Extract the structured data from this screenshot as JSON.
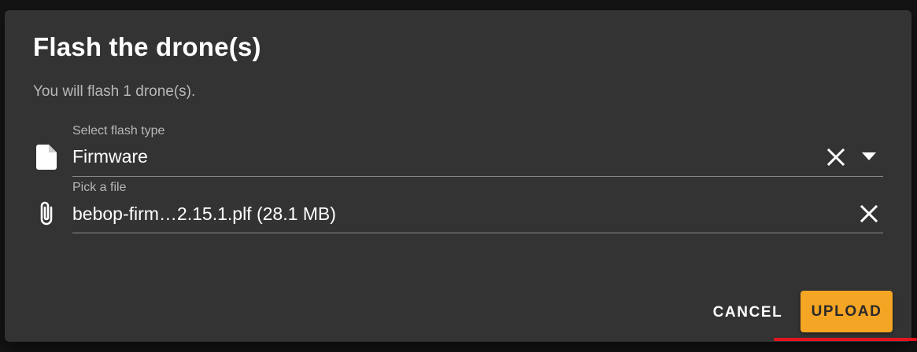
{
  "dialog": {
    "title": "Flash the drone(s)",
    "subtitle": "You will flash 1 drone(s)."
  },
  "flash_type": {
    "label": "Select flash type",
    "value": "Firmware",
    "icon": "file-icon"
  },
  "file_picker": {
    "label": "Pick a file",
    "value": "bebop-firm…2.15.1.plf (28.1 MB)",
    "icon": "paperclip-icon"
  },
  "actions": {
    "cancel_label": "CANCEL",
    "upload_label": "UPLOAD"
  },
  "colors": {
    "accent": "#f5a524",
    "dialog_bg": "#333333",
    "annotation": "#e4141f"
  }
}
